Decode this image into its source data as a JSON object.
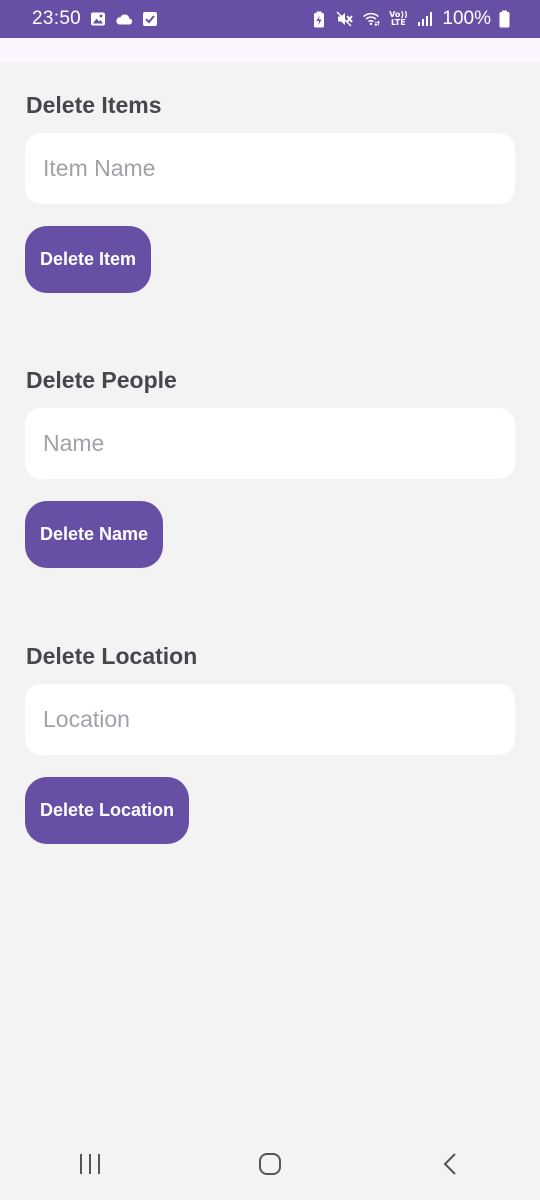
{
  "status_bar": {
    "time": "23:50",
    "battery_percent": "100%",
    "network_label_top": "Vo))",
    "network_label_bottom": "LTE",
    "background_color": "#684fa6",
    "left_icons": [
      "image-icon",
      "cloud-icon",
      "checkbox-icon"
    ],
    "right_icons": [
      "battery-saver-icon",
      "mute-icon",
      "wifi-icon",
      "volte-icon",
      "signal-icon",
      "battery-icon"
    ]
  },
  "sections": {
    "items": {
      "title": "Delete Items",
      "input_placeholder": "Item Name",
      "input_value": "",
      "button_label": "Delete Item"
    },
    "people": {
      "title": "Delete People",
      "input_placeholder": "Name",
      "input_value": "",
      "button_label": "Delete Name"
    },
    "location": {
      "title": "Delete Location",
      "input_placeholder": "Location",
      "input_value": "",
      "button_label": "Delete Location"
    }
  },
  "nav_bar": {
    "icons": [
      "recent-apps-icon",
      "home-icon",
      "back-icon"
    ]
  },
  "colors": {
    "accent": "#684fa6",
    "background": "#f3f3f3",
    "field": "#ffffff",
    "title_text": "#49454f",
    "placeholder": "#a3a0a8"
  }
}
